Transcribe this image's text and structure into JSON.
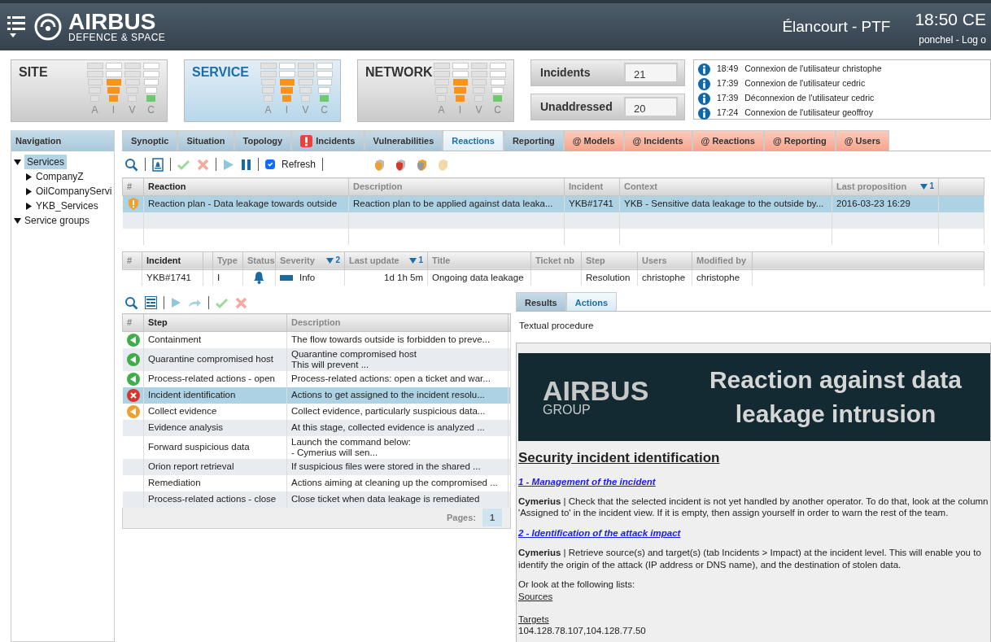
{
  "header": {
    "logo": "AIRBUS",
    "logo_sub": "DEFENCE & SPACE",
    "location": "Élancourt - PTF",
    "clock": "18:50 CE",
    "user": "ponchel -",
    "logout": "Log o"
  },
  "gauges": [
    {
      "title": "SITE",
      "selected": false,
      "columns": [
        {
          "label": "A",
          "active": false,
          "bars": [
            {
              "lit": false
            },
            {
              "lit": false
            },
            {
              "lit": false
            },
            {
              "lit": false
            },
            {
              "lit": false
            }
          ]
        },
        {
          "label": "I",
          "active": true,
          "color": "#f7941d",
          "bars": [
            {
              "lit": false
            },
            {
              "lit": false
            },
            {
              "lit": true
            },
            {
              "lit": true
            },
            {
              "lit": true
            }
          ]
        },
        {
          "label": "V",
          "active": false,
          "bars": [
            {
              "lit": false
            },
            {
              "lit": false
            },
            {
              "lit": false
            },
            {
              "lit": false
            },
            {
              "lit": false
            }
          ]
        },
        {
          "label": "C",
          "active": true,
          "color": "#6cc96c",
          "bars": [
            {
              "lit": false
            },
            {
              "lit": false
            },
            {
              "lit": false
            },
            {
              "lit": false
            },
            {
              "lit": true
            }
          ]
        }
      ]
    },
    {
      "title": "SERVICE",
      "selected": true,
      "columns": [
        {
          "label": "A",
          "active": false,
          "bars": [
            {
              "lit": false
            },
            {
              "lit": false
            },
            {
              "lit": false
            },
            {
              "lit": false
            },
            {
              "lit": false
            }
          ]
        },
        {
          "label": "I",
          "active": true,
          "color": "#f7941d",
          "bars": [
            {
              "lit": false
            },
            {
              "lit": false
            },
            {
              "lit": true
            },
            {
              "lit": true
            },
            {
              "lit": true
            }
          ]
        },
        {
          "label": "V",
          "active": false,
          "bars": [
            {
              "lit": false
            },
            {
              "lit": false
            },
            {
              "lit": false
            },
            {
              "lit": false
            },
            {
              "lit": false
            }
          ]
        },
        {
          "label": "C",
          "active": true,
          "color": "#6cc96c",
          "bars": [
            {
              "lit": false
            },
            {
              "lit": false
            },
            {
              "lit": false
            },
            {
              "lit": false
            },
            {
              "lit": true
            }
          ]
        }
      ]
    },
    {
      "title": "NETWORK",
      "selected": false,
      "columns": [
        {
          "label": "A",
          "active": false,
          "bars": [
            {
              "lit": false
            },
            {
              "lit": false
            },
            {
              "lit": false
            },
            {
              "lit": false
            },
            {
              "lit": false
            }
          ]
        },
        {
          "label": "I",
          "active": true,
          "color": "#f7941d",
          "bars": [
            {
              "lit": false
            },
            {
              "lit": false
            },
            {
              "lit": true
            },
            {
              "lit": true
            },
            {
              "lit": true
            }
          ]
        },
        {
          "label": "V",
          "active": false,
          "bars": [
            {
              "lit": false
            },
            {
              "lit": false
            },
            {
              "lit": false
            },
            {
              "lit": false
            },
            {
              "lit": false
            }
          ]
        },
        {
          "label": "C",
          "active": true,
          "color": "#6cc96c",
          "bars": [
            {
              "lit": false
            },
            {
              "lit": false
            },
            {
              "lit": false
            },
            {
              "lit": false
            },
            {
              "lit": true
            }
          ]
        }
      ]
    }
  ],
  "counters": [
    {
      "label": "Incidents",
      "value": "21"
    },
    {
      "label": "Unaddressed",
      "value": "20"
    }
  ],
  "log": [
    {
      "time": "18:49",
      "text": "Connexion de l'utilisateur christophe"
    },
    {
      "time": "17:39",
      "text": "Connexion de l'utilisateur cedric"
    },
    {
      "time": "17:39",
      "text": "Déconnexion de l'utilisateur cedric"
    },
    {
      "time": "17:24",
      "text": "Connexion de l'utilisateur geoffroy"
    }
  ],
  "navigation": {
    "title": "Navigation",
    "items": [
      {
        "label": "Services",
        "expanded": true,
        "selected": true,
        "children": [
          {
            "label": "CompanyZ",
            "expanded": false,
            "selected": false
          },
          {
            "label": "OilCompanyServi",
            "expanded": false,
            "selected": false
          },
          {
            "label": "YKB_Services",
            "expanded": false,
            "selected": false
          }
        ]
      },
      {
        "label": "Service groups",
        "expanded": true,
        "selected": false
      }
    ]
  },
  "tabs": [
    {
      "label": "Synoptic",
      "kind": "main",
      "selected": false,
      "alert": false
    },
    {
      "label": "Situation",
      "kind": "main",
      "selected": false,
      "alert": false
    },
    {
      "label": "Topology",
      "kind": "main",
      "selected": false,
      "alert": false
    },
    {
      "label": "Incidents",
      "kind": "main",
      "selected": false,
      "alert": true
    },
    {
      "label": "Vulnerabilities",
      "kind": "main",
      "selected": false,
      "alert": false
    },
    {
      "label": "Reactions",
      "kind": "main",
      "selected": true,
      "alert": false
    },
    {
      "label": "Reporting",
      "kind": "main",
      "selected": false,
      "alert": false
    },
    {
      "label": "@ Models",
      "kind": "admin",
      "selected": false,
      "alert": false
    },
    {
      "label": "@ Incidents",
      "kind": "admin",
      "selected": false,
      "alert": false
    },
    {
      "label": "@ Reactions",
      "kind": "admin",
      "selected": false,
      "alert": false
    },
    {
      "label": "@ Reporting",
      "kind": "admin",
      "selected": false,
      "alert": false
    },
    {
      "label": "@ Users",
      "kind": "admin",
      "selected": false,
      "alert": false
    }
  ],
  "toolbar": {
    "refresh": {
      "label": "Refresh",
      "checked": true
    }
  },
  "reactions": {
    "columns": [
      {
        "label": "#"
      },
      {
        "label": "Reaction"
      },
      {
        "label": "Description"
      },
      {
        "label": "Incident"
      },
      {
        "label": "Context"
      },
      {
        "label": "Last proposition",
        "sort": "1"
      }
    ],
    "rows": [
      {
        "selected": true,
        "cells": [
          {
            "kind": "warning"
          },
          {
            "kind": "text",
            "text": "Reaction plan - Data leakage towards outside"
          },
          {
            "kind": "text",
            "text": "Reaction plan to be applied against data leaka..."
          },
          {
            "kind": "text",
            "text": "YKB#1741"
          },
          {
            "kind": "text",
            "text": "YKB - Sensitive data leakage to the outside by..."
          },
          {
            "kind": "text",
            "text": "2016-03-23 16:29"
          }
        ]
      }
    ]
  },
  "incidents": {
    "columns": [
      {
        "label": "#"
      },
      {
        "label": "Incident"
      },
      {
        "kind": "blank"
      },
      {
        "label": "Type"
      },
      {
        "label": "Status"
      },
      {
        "label": "Severity",
        "sort": "2"
      },
      {
        "label": "Last update",
        "sort": "1",
        "numeric": true
      },
      {
        "label": "Title"
      },
      {
        "label": "Ticket nb"
      },
      {
        "label": "Step"
      },
      {
        "label": "Users"
      },
      {
        "label": "Modified by"
      }
    ],
    "rows": [
      {
        "cells": [
          {
            "kind": "empty"
          },
          {
            "kind": "text",
            "text": "YKB#1741"
          },
          {
            "kind": "empty"
          },
          {
            "kind": "text",
            "text": "I"
          },
          {
            "kind": "bell"
          },
          {
            "kind": "severity",
            "text": "Info",
            "color": "#1c6a99"
          },
          {
            "kind": "text",
            "text": "1d 1h 5m"
          },
          {
            "kind": "text",
            "text": "Ongoing data leakage"
          },
          {
            "kind": "empty"
          },
          {
            "kind": "text",
            "text": "Resolution"
          },
          {
            "kind": "text",
            "text": "christophe"
          },
          {
            "kind": "text",
            "text": "christophe"
          }
        ]
      }
    ]
  },
  "steps": {
    "columns": [
      {
        "label": "#"
      },
      {
        "label": "Step"
      },
      {
        "label": "Description"
      }
    ],
    "rows": [
      {
        "kind": "done",
        "selected": false,
        "step": "Containment",
        "description": "The flow towards outside is forbidden to preve..."
      },
      {
        "kind": "done",
        "selected": false,
        "step": "Quarantine compromised host",
        "description": "Quarantine compromised host\nThis will prevent ..."
      },
      {
        "kind": "done",
        "selected": false,
        "step": "Process-related actions - open",
        "description": "Process-related actions: open a ticket and war..."
      },
      {
        "kind": "failed",
        "selected": true,
        "step": "Incident identification",
        "description": "Actions to get assigned to the incident resolu..."
      },
      {
        "kind": "pending",
        "selected": false,
        "step": "Collect evidence",
        "description": "Collect evidence, particularly suspicious data..."
      },
      {
        "kind": "none",
        "selected": false,
        "step": "Evidence analysis",
        "description": "At this stage, collected evidence is analyzed ..."
      },
      {
        "kind": "none",
        "selected": false,
        "step": "Forward suspicious data",
        "description": "Launch the command below:\n- Cymerius will sen..."
      },
      {
        "kind": "none",
        "selected": false,
        "step": "Orion report retrieval",
        "description": "If suspicious files were stored in the shared ..."
      },
      {
        "kind": "none",
        "selected": false,
        "step": "Remediation",
        "description": "Actions aiming at cleaning up the compromised ..."
      },
      {
        "kind": "none",
        "selected": false,
        "step": "Process-related actions - close",
        "description": "Close ticket when data leakage is remediated"
      }
    ],
    "pages_label": "Pages:",
    "page": "1"
  },
  "detail": {
    "tabs": [
      {
        "label": "Results",
        "selected": false
      },
      {
        "label": "Actions",
        "selected": true
      }
    ],
    "caption": "Textual procedure",
    "banner": {
      "logo": "AIRBUS",
      "logo_sub": "GROUP",
      "title": "Reaction against data leakage intrusion"
    },
    "heading": "Security incident identification",
    "blocks": [
      {
        "kind": "link",
        "text": "1 - Management of the incident"
      },
      {
        "kind": "para",
        "text": "**Cymerius** | Check that the selected incident is not yet handled by another operator. To do that, look at the column 'Assigned to' in the incident view. If it is empty, then assign yourself in order to warn the rest of the team."
      },
      {
        "kind": "link",
        "text": "2 - Identification of the attack impact"
      },
      {
        "kind": "para",
        "text": "**Cymerius** | Retrieve source(s) and target(s) (tab Incidents > Impact) at the incident level. This will enable you to identify the origin of the attack (IP address or DNS name), and the destination of stolen data."
      },
      {
        "kind": "line",
        "text": "Or look at the following lists:"
      },
      {
        "kind": "list",
        "text": "Sources"
      },
      {
        "kind": "gap"
      },
      {
        "kind": "list",
        "text": "Targets"
      },
      {
        "kind": "line",
        "text": "104.128.78.107,104.128.77.50"
      }
    ]
  }
}
